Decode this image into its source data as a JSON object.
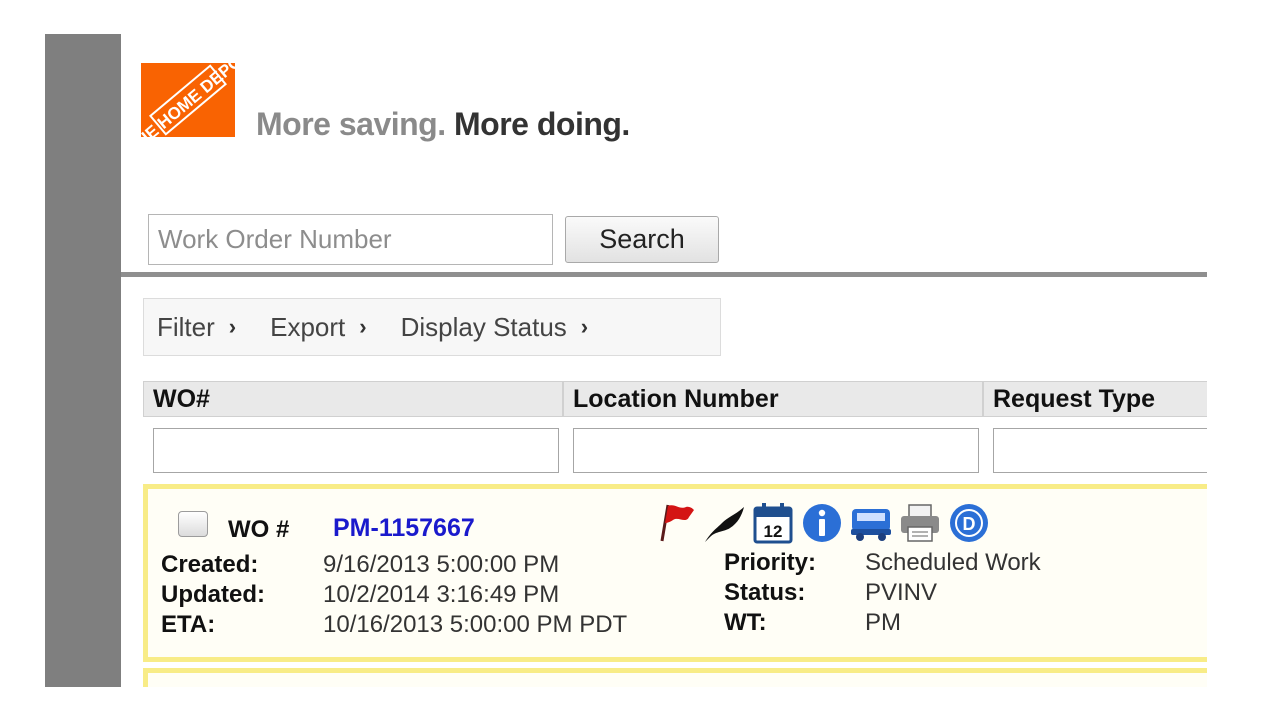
{
  "header": {
    "tagline_part1": "More saving.",
    "tagline_part2": "More doing.",
    "tagline_mark": "ː",
    "logo_text": "THE HOME DEPOT",
    "brand_color": "#f96302"
  },
  "search": {
    "placeholder": "Work Order Number",
    "value": "",
    "button_label": "Search"
  },
  "toolbar": {
    "items": [
      {
        "label": "Filter",
        "chevron": "›"
      },
      {
        "label": "Export",
        "chevron": "›"
      },
      {
        "label": "Display Status",
        "chevron": "›"
      }
    ]
  },
  "grid": {
    "columns": [
      {
        "header": "WO#",
        "filter": ""
      },
      {
        "header": "Location Number",
        "filter": ""
      },
      {
        "header": "Request Type",
        "filter": ""
      }
    ]
  },
  "work_orders": [
    {
      "wo_label": "WO #",
      "wo_number": "PM-1157667",
      "created_label": "Created:",
      "created": "9/16/2013 5:00:00 PM",
      "updated_label": "Updated:",
      "updated": "10/2/2014 3:16:49 PM",
      "eta_label": "ETA:",
      "eta": "10/16/2013 5:00:00 PM PDT",
      "priority_label": "Priority:",
      "priority": "Scheduled Work",
      "status_label": "Status:",
      "status": "PVINV",
      "wt_label": "WT:",
      "wt": "PM",
      "calendar_day": "12",
      "details_letter": "D",
      "icons": [
        "flag-icon",
        "feather-icon",
        "calendar-icon",
        "info-icon",
        "truck-icon",
        "print-icon",
        "details-icon"
      ]
    }
  ],
  "colors": {
    "card_border": "#f8ec87",
    "link": "#1a1acc",
    "flag": "#d41414",
    "icon_blue": "#2b6fd6",
    "sidebar": "#7f7f7f"
  }
}
